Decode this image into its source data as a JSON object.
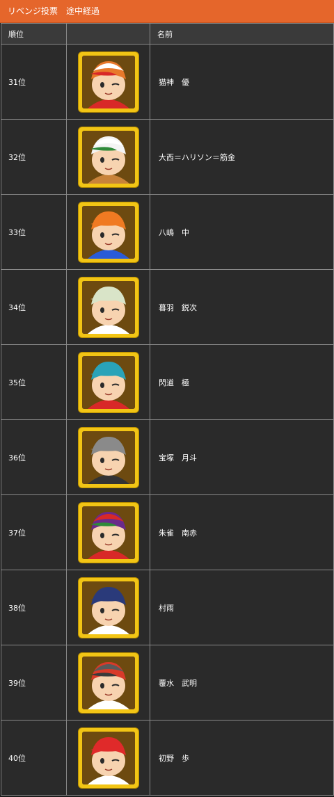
{
  "header": {
    "title": "リベンジ投票　途中経過"
  },
  "table": {
    "columns": [
      "順位",
      "",
      "名前"
    ],
    "rows": [
      {
        "rank": "31位",
        "name": "猫神　優",
        "icon": "hair-orange-cap-white-avatar-icon",
        "colors": {
          "hair": "#e8782a",
          "cap": "#ffffff",
          "brim": "#d82828",
          "shirt": "#d82828"
        }
      },
      {
        "rank": "32位",
        "name": "大西＝ハリソン＝筋金",
        "icon": "hair-white-cap-green-avatar-icon",
        "colors": {
          "hair": "#f4f4f4",
          "cap": "#ffffff",
          "brim": "#2f8a3a",
          "shirt": "#c8833a"
        }
      },
      {
        "rank": "33位",
        "name": "八嶋　中",
        "icon": "hair-orange-spiky-avatar-icon",
        "colors": {
          "hair": "#f07a22",
          "cap": "#f07a22",
          "brim": "#f07a22",
          "shirt": "#2a5bd8"
        }
      },
      {
        "rank": "34位",
        "name": "暮羽　鋭次",
        "icon": "hair-silver-avatar-icon",
        "colors": {
          "hair": "#d9e4c8",
          "cap": "#d9e4c8",
          "brim": "#d9e4c8",
          "shirt": "#ffffff"
        }
      },
      {
        "rank": "35位",
        "name": "閃道　極",
        "icon": "hair-teal-avatar-icon",
        "colors": {
          "hair": "#2aa3b8",
          "cap": "#2aa3b8",
          "brim": "#2aa3b8",
          "shirt": "#d82828"
        }
      },
      {
        "rank": "36位",
        "name": "宝塚　月斗",
        "icon": "hair-gray-avatar-icon",
        "colors": {
          "hair": "#8a8a8a",
          "cap": "#8a8a8a",
          "brim": "#8a8a8a",
          "shirt": "#333333"
        }
      },
      {
        "rank": "37位",
        "name": "朱雀　南赤",
        "icon": "hair-purple-cap-red-avatar-icon",
        "colors": {
          "hair": "#6a2a8a",
          "cap": "#d82828",
          "brim": "#2f8a3a",
          "shirt": "#d82828"
        }
      },
      {
        "rank": "38位",
        "name": "村雨",
        "icon": "hair-navy-avatar-icon",
        "colors": {
          "hair": "#2a3a7a",
          "cap": "#2a3a7a",
          "brim": "#2a3a7a",
          "shirt": "#ffffff"
        }
      },
      {
        "rank": "39位",
        "name": "覆水　武明",
        "icon": "hair-red-cap-gray-avatar-icon",
        "colors": {
          "hair": "#d83a2a",
          "cap": "#5a5a5a",
          "brim": "#3a3a3a",
          "shirt": "#ffffff"
        }
      },
      {
        "rank": "40位",
        "name": "初野　歩",
        "icon": "hair-red-avatar-icon",
        "colors": {
          "hair": "#e02a2a",
          "cap": "#e02a2a",
          "brim": "#e02a2a",
          "shirt": "#ffffff"
        }
      }
    ]
  }
}
